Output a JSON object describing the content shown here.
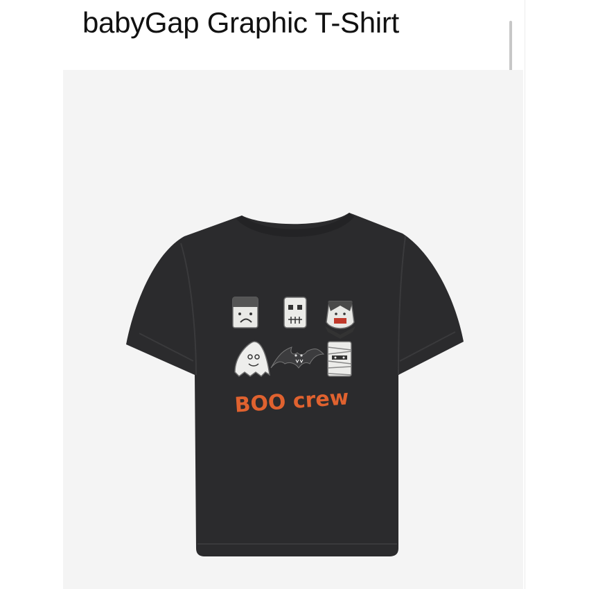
{
  "product": {
    "title": "babyGap Graphic T-Shirt",
    "image": {
      "alt": "Black babyGap t-shirt with Halloween monster graphic",
      "garment_color": "#2b2b2d",
      "background_color": "#f4f4f4",
      "graphic": {
        "icons": [
          "frankenstein-icon",
          "skull-icon",
          "vampire-icon",
          "ghost-icon",
          "bat-icon",
          "mummy-icon"
        ],
        "slogan": "BOO crew",
        "slogan_color": "#e0622f"
      }
    }
  },
  "scrollbar": {
    "thumb_color": "#c7c7c7"
  }
}
